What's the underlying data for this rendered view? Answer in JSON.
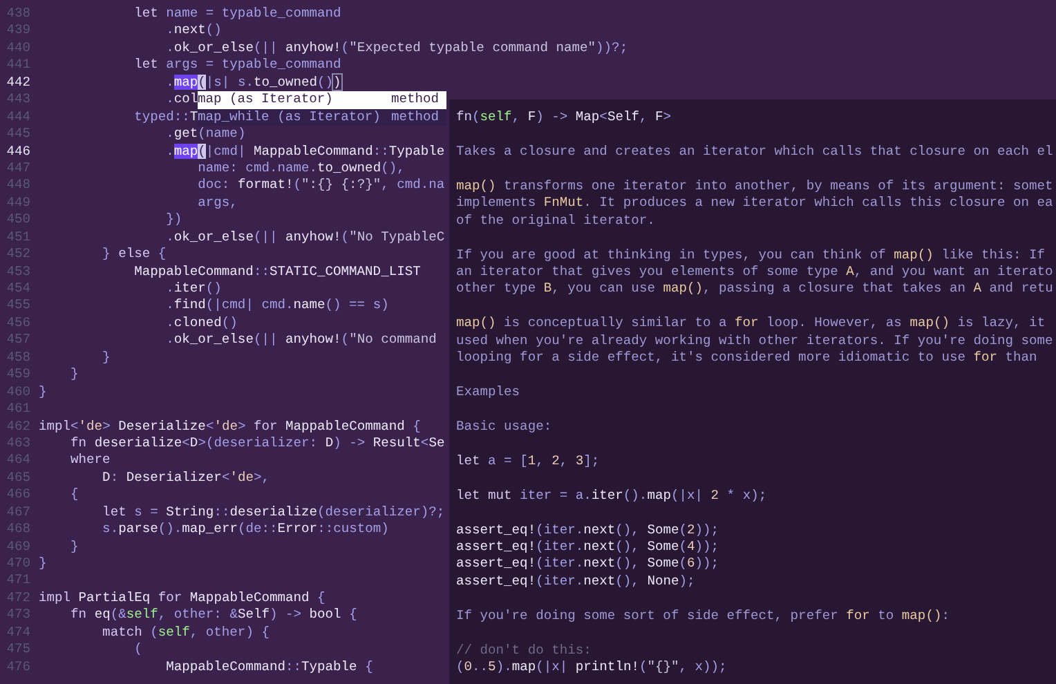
{
  "editor": {
    "lines": [
      {
        "number": "438",
        "current": false,
        "tokens": [
          {
            "kind": "keyword",
            "text": "            let"
          },
          {
            "kind": "plain",
            "text": " name = typable_command"
          }
        ]
      },
      {
        "number": "439",
        "current": false,
        "tokens": [
          {
            "kind": "plain",
            "text": "                ."
          },
          {
            "kind": "name",
            "text": "next"
          },
          {
            "kind": "plain",
            "text": "()"
          }
        ]
      },
      {
        "number": "440",
        "current": false,
        "tokens": [
          {
            "kind": "plain",
            "text": "                ."
          },
          {
            "kind": "name",
            "text": "ok_or_else"
          },
          {
            "kind": "plain",
            "text": "(|| "
          },
          {
            "kind": "name",
            "text": "anyhow!"
          },
          {
            "kind": "plain",
            "text": "("
          },
          {
            "kind": "string",
            "text": "\"Expected typable command name\""
          },
          {
            "kind": "plain",
            "text": "))?;"
          }
        ]
      },
      {
        "number": "441",
        "current": false,
        "tokens": [
          {
            "kind": "keyword",
            "text": "            let"
          },
          {
            "kind": "plain",
            "text": " args = typable_command"
          }
        ]
      },
      {
        "number": "442",
        "current": true,
        "tokens": [
          {
            "kind": "plain",
            "text": "                ."
          },
          {
            "kind": "selection",
            "text": "map"
          },
          {
            "kind": "cursor",
            "text": "("
          },
          {
            "kind": "plain",
            "text": "|s| s."
          },
          {
            "kind": "name",
            "text": "to_owned"
          },
          {
            "kind": "plain",
            "text": "()"
          },
          {
            "kind": "bracket",
            "text": ")"
          }
        ]
      },
      {
        "number": "443",
        "current": false,
        "tokens": [
          {
            "kind": "plain",
            "text": "                ."
          },
          {
            "kind": "name",
            "text": "col"
          }
        ]
      },
      {
        "number": "444",
        "current": false,
        "tokens": [
          {
            "kind": "plain",
            "text": "            typed::"
          },
          {
            "kind": "name",
            "text": "T"
          }
        ]
      },
      {
        "number": "445",
        "current": false,
        "tokens": [
          {
            "kind": "plain",
            "text": "                ."
          },
          {
            "kind": "name",
            "text": "get"
          },
          {
            "kind": "plain",
            "text": "(name)"
          }
        ]
      },
      {
        "number": "446",
        "current": true,
        "tokens": [
          {
            "kind": "plain",
            "text": "                ."
          },
          {
            "kind": "selection",
            "text": "map"
          },
          {
            "kind": "cursor",
            "text": "("
          },
          {
            "kind": "plain",
            "text": "|cmd| "
          },
          {
            "kind": "name",
            "text": "MappableCommand"
          },
          {
            "kind": "plain",
            "text": "::"
          },
          {
            "kind": "name",
            "text": "Typable"
          }
        ]
      },
      {
        "number": "447",
        "current": false,
        "tokens": [
          {
            "kind": "plain",
            "text": "                    name: cmd.name."
          },
          {
            "kind": "name",
            "text": "to_owned"
          },
          {
            "kind": "plain",
            "text": "(),"
          }
        ]
      },
      {
        "number": "448",
        "current": false,
        "tokens": [
          {
            "kind": "plain",
            "text": "                    doc: "
          },
          {
            "kind": "name",
            "text": "format!"
          },
          {
            "kind": "plain",
            "text": "("
          },
          {
            "kind": "string",
            "text": "\":{} {:?}\""
          },
          {
            "kind": "plain",
            "text": ", cmd.na"
          }
        ]
      },
      {
        "number": "449",
        "current": false,
        "tokens": [
          {
            "kind": "plain",
            "text": "                    args,"
          }
        ]
      },
      {
        "number": "450",
        "current": false,
        "tokens": [
          {
            "kind": "plain",
            "text": "                })"
          }
        ]
      },
      {
        "number": "451",
        "current": false,
        "tokens": [
          {
            "kind": "plain",
            "text": "                ."
          },
          {
            "kind": "name",
            "text": "ok_or_else"
          },
          {
            "kind": "plain",
            "text": "(|| "
          },
          {
            "kind": "name",
            "text": "anyhow!"
          },
          {
            "kind": "plain",
            "text": "("
          },
          {
            "kind": "string",
            "text": "\"No TypableC"
          }
        ]
      },
      {
        "number": "452",
        "current": false,
        "tokens": [
          {
            "kind": "plain",
            "text": "        } "
          },
          {
            "kind": "keyword",
            "text": "else"
          },
          {
            "kind": "plain",
            "text": " {"
          }
        ]
      },
      {
        "number": "453",
        "current": false,
        "tokens": [
          {
            "kind": "name",
            "text": "            MappableCommand"
          },
          {
            "kind": "plain",
            "text": "::"
          },
          {
            "kind": "name",
            "text": "STATIC_COMMAND_LIST"
          }
        ]
      },
      {
        "number": "454",
        "current": false,
        "tokens": [
          {
            "kind": "plain",
            "text": "                ."
          },
          {
            "kind": "name",
            "text": "iter"
          },
          {
            "kind": "plain",
            "text": "()"
          }
        ]
      },
      {
        "number": "455",
        "current": false,
        "tokens": [
          {
            "kind": "plain",
            "text": "                ."
          },
          {
            "kind": "name",
            "text": "find"
          },
          {
            "kind": "plain",
            "text": "(|cmd| cmd."
          },
          {
            "kind": "name",
            "text": "name"
          },
          {
            "kind": "plain",
            "text": "() == s)"
          }
        ]
      },
      {
        "number": "456",
        "current": false,
        "tokens": [
          {
            "kind": "plain",
            "text": "                ."
          },
          {
            "kind": "name",
            "text": "cloned"
          },
          {
            "kind": "plain",
            "text": "()"
          }
        ]
      },
      {
        "number": "457",
        "current": false,
        "tokens": [
          {
            "kind": "plain",
            "text": "                ."
          },
          {
            "kind": "name",
            "text": "ok_or_else"
          },
          {
            "kind": "plain",
            "text": "(|| "
          },
          {
            "kind": "name",
            "text": "anyhow!"
          },
          {
            "kind": "plain",
            "text": "("
          },
          {
            "kind": "string",
            "text": "\"No command"
          }
        ]
      },
      {
        "number": "458",
        "current": false,
        "tokens": [
          {
            "kind": "plain",
            "text": "        }"
          }
        ]
      },
      {
        "number": "459",
        "current": false,
        "tokens": [
          {
            "kind": "plain",
            "text": "    }"
          }
        ]
      },
      {
        "number": "460",
        "current": false,
        "tokens": [
          {
            "kind": "plain",
            "text": "}"
          }
        ]
      },
      {
        "number": "461",
        "current": false
      },
      {
        "number": "462",
        "current": false,
        "tokens": [
          {
            "kind": "keyword",
            "text": "impl"
          },
          {
            "kind": "plain",
            "text": "<"
          },
          {
            "kind": "literal",
            "text": "'de"
          },
          {
            "kind": "plain",
            "text": "> "
          },
          {
            "kind": "name",
            "text": "Deserialize"
          },
          {
            "kind": "plain",
            "text": "<"
          },
          {
            "kind": "literal",
            "text": "'de"
          },
          {
            "kind": "plain",
            "text": "> "
          },
          {
            "kind": "keyword",
            "text": "for "
          },
          {
            "kind": "name",
            "text": "MappableCommand"
          },
          {
            "kind": "plain",
            "text": " {"
          }
        ]
      },
      {
        "number": "463",
        "current": false,
        "tokens": [
          {
            "kind": "keyword",
            "text": "    fn "
          },
          {
            "kind": "name",
            "text": "deserialize"
          },
          {
            "kind": "plain",
            "text": "<"
          },
          {
            "kind": "name",
            "text": "D"
          },
          {
            "kind": "plain",
            "text": ">(deserializer: "
          },
          {
            "kind": "name",
            "text": "D"
          },
          {
            "kind": "plain",
            "text": ") -> "
          },
          {
            "kind": "name",
            "text": "Result"
          },
          {
            "kind": "plain",
            "text": "<"
          },
          {
            "kind": "name",
            "text": "Se"
          }
        ]
      },
      {
        "number": "464",
        "current": false,
        "tokens": [
          {
            "kind": "keyword",
            "text": "    where"
          }
        ]
      },
      {
        "number": "465",
        "current": false,
        "tokens": [
          {
            "kind": "name",
            "text": "        D"
          },
          {
            "kind": "plain",
            "text": ": "
          },
          {
            "kind": "name",
            "text": "Deserializer"
          },
          {
            "kind": "plain",
            "text": "<"
          },
          {
            "kind": "literal",
            "text": "'de"
          },
          {
            "kind": "plain",
            "text": ">,"
          }
        ]
      },
      {
        "number": "466",
        "current": false,
        "tokens": [
          {
            "kind": "plain",
            "text": "    {"
          }
        ]
      },
      {
        "number": "467",
        "current": false,
        "tokens": [
          {
            "kind": "keyword",
            "text": "        let"
          },
          {
            "kind": "plain",
            "text": " s = "
          },
          {
            "kind": "name",
            "text": "String"
          },
          {
            "kind": "plain",
            "text": "::"
          },
          {
            "kind": "name",
            "text": "deserialize"
          },
          {
            "kind": "plain",
            "text": "(deserializer)?;"
          }
        ]
      },
      {
        "number": "468",
        "current": false,
        "tokens": [
          {
            "kind": "plain",
            "text": "        s."
          },
          {
            "kind": "name",
            "text": "parse"
          },
          {
            "kind": "plain",
            "text": "()."
          },
          {
            "kind": "name",
            "text": "map_err"
          },
          {
            "kind": "plain",
            "text": "(de::"
          },
          {
            "kind": "name",
            "text": "Error"
          },
          {
            "kind": "plain",
            "text": "::custom)"
          }
        ]
      },
      {
        "number": "469",
        "current": false,
        "tokens": [
          {
            "kind": "plain",
            "text": "    }"
          }
        ]
      },
      {
        "number": "470",
        "current": false,
        "tokens": [
          {
            "kind": "plain",
            "text": "}"
          }
        ]
      },
      {
        "number": "471",
        "current": false
      },
      {
        "number": "472",
        "current": false,
        "tokens": [
          {
            "kind": "keyword",
            "text": "impl "
          },
          {
            "kind": "name",
            "text": "PartialEq"
          },
          {
            "kind": "keyword",
            "text": " for "
          },
          {
            "kind": "name",
            "text": "MappableCommand"
          },
          {
            "kind": "plain",
            "text": " {"
          }
        ]
      },
      {
        "number": "473",
        "current": false,
        "tokens": [
          {
            "kind": "keyword",
            "text": "    fn "
          },
          {
            "kind": "name",
            "text": "eq"
          },
          {
            "kind": "plain",
            "text": "(&"
          },
          {
            "kind": "builtin",
            "text": "self"
          },
          {
            "kind": "plain",
            "text": ", other: &"
          },
          {
            "kind": "name",
            "text": "Self"
          },
          {
            "kind": "plain",
            "text": ") -> "
          },
          {
            "kind": "name",
            "text": "bool"
          },
          {
            "kind": "plain",
            "text": " {"
          }
        ]
      },
      {
        "number": "474",
        "current": false,
        "tokens": [
          {
            "kind": "keyword",
            "text": "        match"
          },
          {
            "kind": "plain",
            "text": " ("
          },
          {
            "kind": "builtin",
            "text": "self"
          },
          {
            "kind": "plain",
            "text": ", other) {"
          }
        ]
      },
      {
        "number": "475",
        "current": false,
        "tokens": [
          {
            "kind": "plain",
            "text": "            ("
          }
        ]
      },
      {
        "number": "476",
        "current": false,
        "tokens": [
          {
            "kind": "name",
            "text": "                MappableCommand"
          },
          {
            "kind": "plain",
            "text": "::"
          },
          {
            "kind": "name",
            "text": "Typable"
          },
          {
            "kind": "plain",
            "text": " {"
          }
        ]
      }
    ]
  },
  "completion": {
    "items": [
      {
        "label": "map (as Iterator)",
        "detail": "method",
        "selected": true
      },
      {
        "label": "map_while (as Iterator)",
        "detail": "method",
        "selected": false
      }
    ]
  },
  "documentation": {
    "signature": [
      {
        "kind": "keyword",
        "text": "fn"
      },
      {
        "kind": "plain",
        "text": "("
      },
      {
        "kind": "builtin",
        "text": "self"
      },
      {
        "kind": "plain",
        "text": ", "
      },
      {
        "kind": "name",
        "text": "F"
      },
      {
        "kind": "plain",
        "text": ") -> "
      },
      {
        "kind": "name",
        "text": "Map"
      },
      {
        "kind": "plain",
        "text": "<"
      },
      {
        "kind": "name",
        "text": "Self"
      },
      {
        "kind": "plain",
        "text": ", "
      },
      {
        "kind": "name",
        "text": "F"
      },
      {
        "kind": "plain",
        "text": ">"
      }
    ],
    "paragraphs": [
      {
        "lines": [
          [
            {
              "kind": "prose",
              "text": "Takes a closure and creates an iterator which calls that closure on each el"
            }
          ]
        ]
      },
      {
        "lines": [
          [
            {
              "kind": "code",
              "text": "map()"
            },
            {
              "kind": "prose",
              "text": " transforms one iterator into another, by means of its argument: somet"
            }
          ],
          [
            {
              "kind": "prose",
              "text": "implements "
            },
            {
              "kind": "code",
              "text": "FnMut"
            },
            {
              "kind": "prose",
              "text": ". It produces a new iterator which calls this closure on ea"
            }
          ],
          [
            {
              "kind": "prose",
              "text": "of the original iterator."
            }
          ]
        ]
      },
      {
        "lines": [
          [
            {
              "kind": "prose",
              "text": "If you are good at thinking in types, you can think of "
            },
            {
              "kind": "code",
              "text": "map()"
            },
            {
              "kind": "prose",
              "text": " like this: If"
            }
          ],
          [
            {
              "kind": "prose",
              "text": "an iterator that gives you elements of some type "
            },
            {
              "kind": "code",
              "text": "A"
            },
            {
              "kind": "prose",
              "text": ", and you want an iterato"
            }
          ],
          [
            {
              "kind": "prose",
              "text": "other type "
            },
            {
              "kind": "code",
              "text": "B"
            },
            {
              "kind": "prose",
              "text": ", you can use "
            },
            {
              "kind": "code",
              "text": "map()"
            },
            {
              "kind": "prose",
              "text": ", passing a closure that takes an "
            },
            {
              "kind": "code",
              "text": "A"
            },
            {
              "kind": "prose",
              "text": " and retu"
            }
          ]
        ]
      },
      {
        "lines": [
          [
            {
              "kind": "code",
              "text": "map()"
            },
            {
              "kind": "prose",
              "text": " is conceptually similar to a "
            },
            {
              "kind": "code",
              "text": "for"
            },
            {
              "kind": "prose",
              "text": " loop. However, as "
            },
            {
              "kind": "code",
              "text": "map()"
            },
            {
              "kind": "prose",
              "text": " is lazy, it"
            }
          ],
          [
            {
              "kind": "prose",
              "text": "used when you're already working with other iterators. If you're doing some"
            }
          ],
          [
            {
              "kind": "prose",
              "text": "looping for a side effect, it's considered more idiomatic to use "
            },
            {
              "kind": "code",
              "text": "for"
            },
            {
              "kind": "prose",
              "text": " than"
            }
          ]
        ]
      },
      {
        "lines": [
          [
            {
              "kind": "prose",
              "text": "Examples"
            }
          ]
        ]
      },
      {
        "lines": [
          [
            {
              "kind": "prose",
              "text": "Basic usage:"
            }
          ]
        ]
      },
      {
        "lines": [
          [
            {
              "kind": "keyword",
              "text": "let"
            },
            {
              "kind": "plain",
              "text": " a = ["
            },
            {
              "kind": "literal",
              "text": "1"
            },
            {
              "kind": "plain",
              "text": ", "
            },
            {
              "kind": "literal",
              "text": "2"
            },
            {
              "kind": "plain",
              "text": ", "
            },
            {
              "kind": "literal",
              "text": "3"
            },
            {
              "kind": "plain",
              "text": "];"
            }
          ]
        ]
      },
      {
        "lines": [
          [
            {
              "kind": "keyword",
              "text": "let mut"
            },
            {
              "kind": "plain",
              "text": " iter = a."
            },
            {
              "kind": "name",
              "text": "iter"
            },
            {
              "kind": "plain",
              "text": "()."
            },
            {
              "kind": "name",
              "text": "map"
            },
            {
              "kind": "plain",
              "text": "(|x| "
            },
            {
              "kind": "literal",
              "text": "2"
            },
            {
              "kind": "plain",
              "text": " * x);"
            }
          ]
        ]
      },
      {
        "lines": [
          [
            {
              "kind": "name",
              "text": "assert_eq!"
            },
            {
              "kind": "plain",
              "text": "(iter."
            },
            {
              "kind": "name",
              "text": "next"
            },
            {
              "kind": "plain",
              "text": "(), "
            },
            {
              "kind": "name",
              "text": "Some"
            },
            {
              "kind": "plain",
              "text": "("
            },
            {
              "kind": "literal",
              "text": "2"
            },
            {
              "kind": "plain",
              "text": "));"
            }
          ],
          [
            {
              "kind": "name",
              "text": "assert_eq!"
            },
            {
              "kind": "plain",
              "text": "(iter."
            },
            {
              "kind": "name",
              "text": "next"
            },
            {
              "kind": "plain",
              "text": "(), "
            },
            {
              "kind": "name",
              "text": "Some"
            },
            {
              "kind": "plain",
              "text": "("
            },
            {
              "kind": "literal",
              "text": "4"
            },
            {
              "kind": "plain",
              "text": "));"
            }
          ],
          [
            {
              "kind": "name",
              "text": "assert_eq!"
            },
            {
              "kind": "plain",
              "text": "(iter."
            },
            {
              "kind": "name",
              "text": "next"
            },
            {
              "kind": "plain",
              "text": "(), "
            },
            {
              "kind": "name",
              "text": "Some"
            },
            {
              "kind": "plain",
              "text": "("
            },
            {
              "kind": "literal",
              "text": "6"
            },
            {
              "kind": "plain",
              "text": "));"
            }
          ],
          [
            {
              "kind": "name",
              "text": "assert_eq!"
            },
            {
              "kind": "plain",
              "text": "(iter."
            },
            {
              "kind": "name",
              "text": "next"
            },
            {
              "kind": "plain",
              "text": "(), "
            },
            {
              "kind": "name",
              "text": "None"
            },
            {
              "kind": "plain",
              "text": ");"
            }
          ]
        ]
      },
      {
        "lines": [
          [
            {
              "kind": "prose",
              "text": "If you're doing some sort of side effect, prefer "
            },
            {
              "kind": "code",
              "text": "for"
            },
            {
              "kind": "prose",
              "text": " to "
            },
            {
              "kind": "code",
              "text": "map()"
            },
            {
              "kind": "prose",
              "text": ":"
            }
          ]
        ]
      },
      {
        "lines": [
          [
            {
              "kind": "comment",
              "text": "// don't do this:"
            }
          ],
          [
            {
              "kind": "plain",
              "text": "("
            },
            {
              "kind": "literal",
              "text": "0"
            },
            {
              "kind": "plain",
              "text": ".."
            },
            {
              "kind": "literal",
              "text": "5"
            },
            {
              "kind": "plain",
              "text": ")."
            },
            {
              "kind": "name",
              "text": "map"
            },
            {
              "kind": "plain",
              "text": "(|x| "
            },
            {
              "kind": "name",
              "text": "println!"
            },
            {
              "kind": "plain",
              "text": "("
            },
            {
              "kind": "string",
              "text": "\"{}\""
            },
            {
              "kind": "plain",
              "text": ", x));"
            }
          ]
        ]
      }
    ]
  }
}
